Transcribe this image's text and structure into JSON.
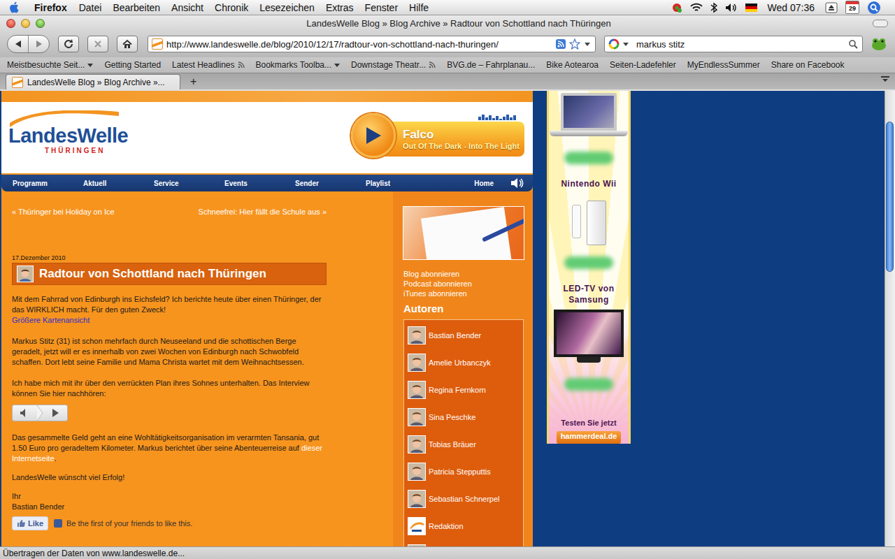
{
  "menubar": {
    "app": "Firefox",
    "menus": [
      "Datei",
      "Bearbeiten",
      "Ansicht",
      "Chronik",
      "Lesezeichen",
      "Extras",
      "Fenster",
      "Hilfe"
    ],
    "clock": "Wed 07:36",
    "calendar_day": "29"
  },
  "window": {
    "title": "LandesWelle Blog » Blog Archive » Radtour von Schottland nach Thüringen"
  },
  "toolbar": {
    "url": "http://www.landeswelle.de/blog/2010/12/17/radtour-von-schottland-nach-thuringen/",
    "search": "markus stitz",
    "bookmarked": false
  },
  "bookmarks": [
    {
      "label": "Meistbesuchte Seit...",
      "kind": "folder"
    },
    {
      "label": "Getting Started",
      "kind": "link"
    },
    {
      "label": "Latest Headlines",
      "kind": "feed"
    },
    {
      "label": "Bookmarks Toolba...",
      "kind": "folder"
    },
    {
      "label": "Downstage Theatr...",
      "kind": "feed"
    },
    {
      "label": "BVG.de – Fahrplanau...",
      "kind": "link"
    },
    {
      "label": "Bike Aotearoa",
      "kind": "link"
    },
    {
      "label": "Seiten-Ladefehler",
      "kind": "link"
    },
    {
      "label": "MyEndlessSummer",
      "kind": "link"
    },
    {
      "label": "Share on Facebook",
      "kind": "link"
    }
  ],
  "tabs": [
    {
      "label": "LandesWelle Blog » Blog Archive »...",
      "selected": true
    }
  ],
  "new_tab": "+",
  "site": {
    "logo": {
      "name": "LandesWelle",
      "region": "THÜRINGEN"
    },
    "now_playing": {
      "artist": "Falco",
      "title": "Out Of The Dark - Into The Light",
      "playing": false
    },
    "nav": [
      {
        "label": "Programm",
        "selected": false
      },
      {
        "label": "Aktuell",
        "selected": false
      },
      {
        "label": "Service",
        "selected": false
      },
      {
        "label": "Events",
        "selected": false
      },
      {
        "label": "Sender",
        "selected": false
      },
      {
        "label": "Playlist",
        "selected": false
      }
    ],
    "nav_home": "Home",
    "post_nav": {
      "previous": "« Thüringer bei Holiday on Ice",
      "next": "Schneefrei: Hier fällt die Schule aus »"
    },
    "post": {
      "date": "17.Dezember 2010",
      "title": "Radtour von Schottland nach Thüringen",
      "intro": "Mit dem Fahrrad von Edinburgh ins Eichsfeld? Ich berichte heute über einen Thüringer, der das WIRKLICH macht. Für den guten Zweck!",
      "map_link": "Größere Kartenansicht",
      "paragraphs": [
        "Markus Stitz (31) ist schon mehrfach durch Neuseeland und die schottischen Berge geradelt, jetzt will er es innerhalb von zwei Wochen von Edinburgh nach Schwobfeld schaffen. Dort lebt seine Familie und Mama Christa wartet mit dem Weihnachtsessen.",
        "Ich habe mich mit ihr über den verrückten Plan ihres Sohnes unterhalten. Das Interview können Sie hier nachhören:"
      ],
      "audio": {
        "playing": false
      },
      "closing": {
        "before": "Das gesammelte Geld geht an eine Wohltätigkeitsorganisation im verarmten Tansania, gut 1.50 Euro pro geradeltem Kilometer. Markus berichtet über seine Abenteuerreise auf ",
        "link": "dieser Internetseite",
        "after": "."
      },
      "wish": "LandesWelle wünscht viel Erfolg!",
      "signature": [
        "Ihr",
        "Bastian Bender"
      ]
    },
    "like": {
      "button": "Like",
      "text": "Be the first of your friends to like this."
    },
    "sidebar": {
      "links": [
        "Blog abonnieren",
        "Podcast abonnieren",
        "iTunes abonnieren"
      ],
      "authors_heading": "Autoren",
      "authors": [
        {
          "name": "Bastian Bender",
          "kind": "person"
        },
        {
          "name": "Amelie Urbanczyk",
          "kind": "person"
        },
        {
          "name": "Regina Fernkorn",
          "kind": "person"
        },
        {
          "name": "Sina Peschke",
          "kind": "person"
        },
        {
          "name": "Tobias Bräuer",
          "kind": "person"
        },
        {
          "name": "Patricia Stepputtis",
          "kind": "person"
        },
        {
          "name": "Sebastian Schnerpel",
          "kind": "person"
        },
        {
          "name": "Redaktion",
          "kind": "team"
        }
      ]
    }
  },
  "ad": {
    "items": [
      {
        "kind": "laptop",
        "label": []
      },
      {
        "kind": "console",
        "label": [
          "Nintendo Wii"
        ]
      },
      {
        "kind": "tv",
        "label": [
          "LED-TV von",
          "Samsung"
        ]
      }
    ],
    "cta": "Testen Sie jetzt",
    "brand": "hammerdeal.de"
  },
  "scrollbar": {
    "level": 0.1,
    "thumb": 0.33
  },
  "status_bar": "Übertragen der Daten von www.landeswelle.de..."
}
